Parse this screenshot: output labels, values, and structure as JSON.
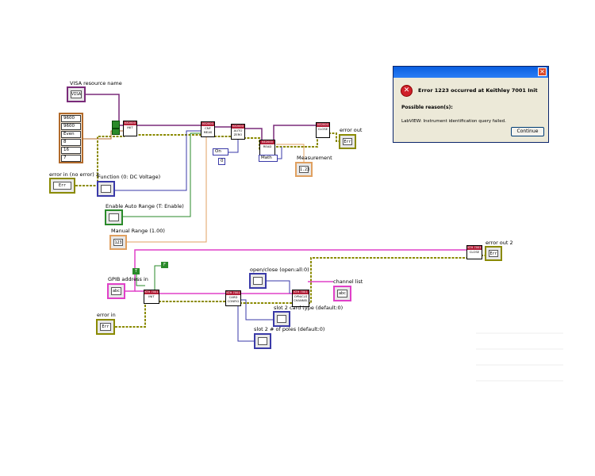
{
  "labels": {
    "visa_resource_name": "VISA resource name",
    "error_in_no_error_2": "error in (no error) 2",
    "function_dc_voltage": "Function (0: DC Voltage)",
    "enable_auto_range": "Enable Auto Range (T: Enable)",
    "manual_range": "Manual Range (1.00)",
    "measurement": "Measurement",
    "error_out": "error out",
    "error_out_2": "error out 2",
    "gpib_address_in": "GPIB address in",
    "error_in": "error in",
    "open_close": "open/close (open:all:0)",
    "channel_list": "channel list",
    "slot2_card_type": "slot 2 card type (default:0)",
    "slot2_num_poles": "slot 2 # of poles (default:0)"
  },
  "controls": {
    "visa_terminal": "VISA",
    "baud_rate_a": "9600",
    "baud_rate_b": "9600",
    "data_bits": "8",
    "parity": "Even",
    "stop_bits": "1",
    "flow_control": "16",
    "timeout": "7",
    "on_ring": "On",
    "on_ring_const": "0",
    "math_ring": "Math",
    "numeric_123": "123",
    "manual_range_terminal": "123",
    "measurement_terminal": "1.23",
    "gpib_terminal": "abc",
    "channel_list_terminal": "abc",
    "bool_t": "T",
    "bool_f": "F",
    "err_term": "Err"
  },
  "vis": {
    "init": {
      "header": "KE2000",
      "body": "INIT"
    },
    "config": {
      "header": "KE2000",
      "body": "CNF MEAS"
    },
    "autozero": {
      "header": "KE2000",
      "body": "AUTO ZERO"
    },
    "read": {
      "header": "KE2000",
      "body": "READ"
    },
    "close": {
      "header": "KE2000",
      "body": "CLOSE"
    },
    "ke7001_init": {
      "header": "KTH 7001",
      "body": "INIT"
    },
    "ke7001_card_config": {
      "header": "KTH 7001",
      "body": "CARD CONFIG"
    },
    "ke7001_open_close": {
      "header": "KTH 7001",
      "body": "OPN/CLS CHANNEL"
    },
    "ke7001_close": {
      "header": "KTH 7001",
      "body": "CLOSE"
    }
  },
  "dialog": {
    "title": "Error 1223 occurred at  Keithley 7001 Init",
    "subtitle": "Possible reason(s):",
    "message": "LabVIEW:  Instrument identification query failed.",
    "button": "Continue",
    "close_glyph": "✕",
    "icon_glyph": "✕",
    "icon": "error-icon",
    "accent": "#0a5fe0"
  },
  "colors": {
    "error_wire": "#8a8a00",
    "visa_wire": "#7a2b7a",
    "string_wire": "#e040c8",
    "numeric_wire": "#e0a060",
    "bool_wire": "#2a8a2a",
    "enum_wire": "#3a3aa8"
  }
}
